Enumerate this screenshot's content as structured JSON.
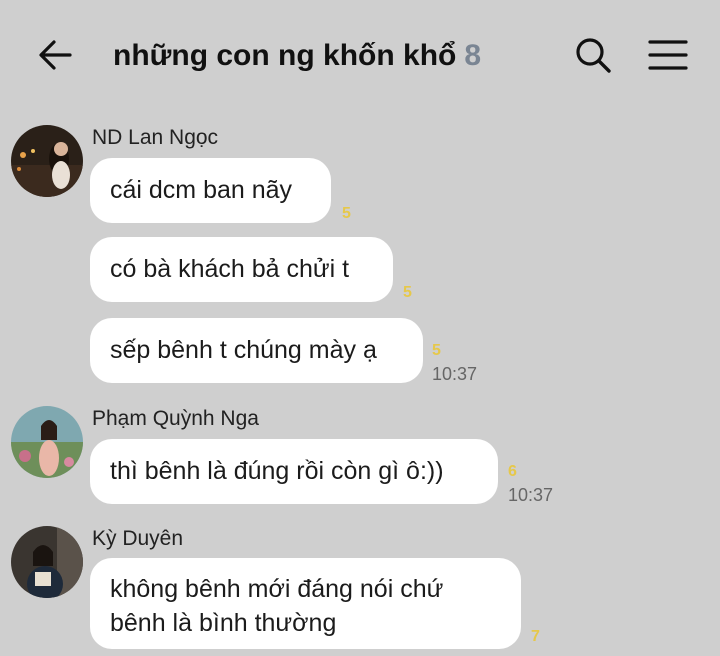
{
  "header": {
    "title": "những con ng khốn khổ",
    "member_count": "8"
  },
  "colors": {
    "background": "#cfcfcf",
    "bubble": "#ffffff",
    "read_count": "#e6c84a",
    "member_count": "#7a8593"
  },
  "messages": [
    {
      "sender": "ND Lan Ngọc",
      "bubbles": [
        {
          "text": "cái dcm ban nãy",
          "reads": "5"
        },
        {
          "text": "có bà khách bả chửi t",
          "reads": "5"
        },
        {
          "text": "sếp bênh t chúng mày ạ",
          "reads": "5",
          "time": "10:37"
        }
      ]
    },
    {
      "sender": "Phạm Quỳnh Nga",
      "bubbles": [
        {
          "text": "thì bênh là đúng rồi còn gì ô:))",
          "reads": "6",
          "time": "10:37"
        }
      ]
    },
    {
      "sender": "Kỳ Duyên",
      "bubbles": [
        {
          "text": "không bênh mới đáng nói chứ bênh là bình thường",
          "reads": "7"
        }
      ]
    }
  ]
}
